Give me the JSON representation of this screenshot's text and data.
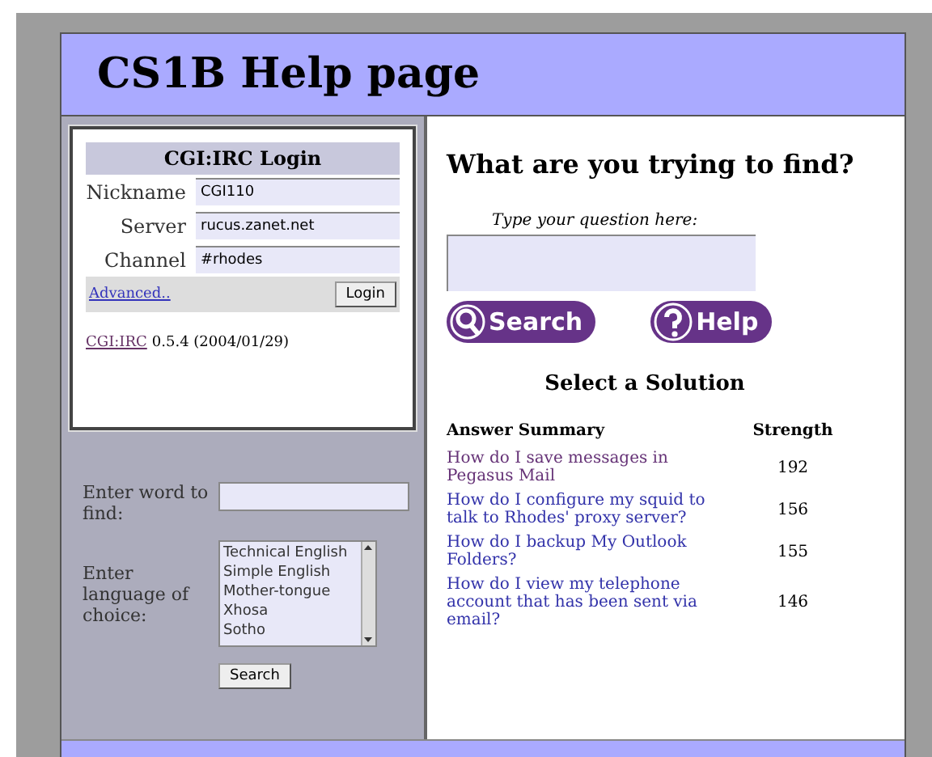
{
  "header": {
    "title": "CS1B Help page"
  },
  "login": {
    "title": "CGI:IRC Login",
    "fields": [
      {
        "label": "Nickname",
        "value": "CGI110"
      },
      {
        "label": "Server",
        "value": "rucus.zanet.net"
      },
      {
        "label": "Channel",
        "value": "#rhodes"
      }
    ],
    "advanced": "Advanced..",
    "button": "Login",
    "version_link": "CGI:IRC",
    "version_text": "0.5.4 (2004/01/29)"
  },
  "word_search": {
    "word_label": "Enter word to find:",
    "language_label": "Enter language of choice:",
    "languages": [
      "Technical English",
      "Simple English",
      "Mother-tongue",
      "Xhosa",
      "Sotho"
    ],
    "button": "Search"
  },
  "question": {
    "heading": "What are you trying to find?",
    "prompt": "Type your question here:",
    "search_button": "Search",
    "help_button": "Help"
  },
  "solutions": {
    "heading": "Select a Solution",
    "columns": [
      "Answer Summary",
      "Strength"
    ],
    "rows": [
      {
        "summary": "How do I save messages in Pegasus Mail",
        "strength": "192",
        "visited": true
      },
      {
        "summary": "How do I configure my squid to talk to Rhodes' proxy server?",
        "strength": "156",
        "visited": false
      },
      {
        "summary": "How do I backup My Outlook Folders?",
        "strength": "155",
        "visited": false
      },
      {
        "summary": "How do I view my telephone account that has been sent via email?",
        "strength": "146",
        "visited": false
      }
    ]
  }
}
